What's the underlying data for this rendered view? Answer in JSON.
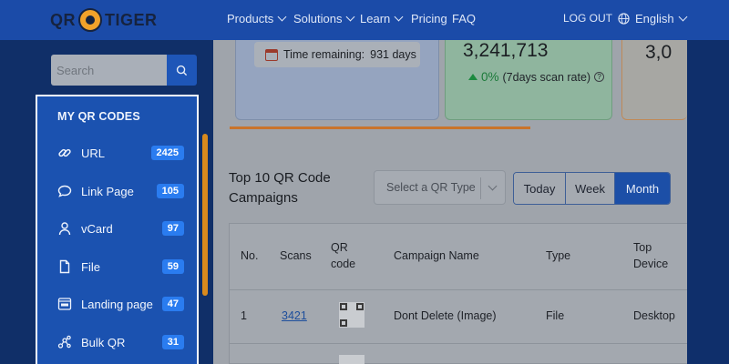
{
  "nav": {
    "logo_left": "QR",
    "logo_right": "TIGER",
    "items": [
      {
        "label": "Products",
        "dropdown": true
      },
      {
        "label": "Solutions",
        "dropdown": true
      },
      {
        "label": "Learn",
        "dropdown": true
      },
      {
        "label": "Pricing",
        "dropdown": false
      },
      {
        "label": "FAQ",
        "dropdown": false
      }
    ],
    "logout": "LOG OUT",
    "language": "English"
  },
  "sidebar": {
    "search_placeholder": "Search",
    "title": "MY QR CODES",
    "items": [
      {
        "label": "URL",
        "count": "2425",
        "icon": "link-icon"
      },
      {
        "label": "Link Page",
        "count": "105",
        "icon": "chat-bubble-icon"
      },
      {
        "label": "vCard",
        "count": "97",
        "icon": "user-icon"
      },
      {
        "label": "File",
        "count": "59",
        "icon": "file-icon"
      },
      {
        "label": "Landing page",
        "count": "47",
        "icon": "landing-page-icon"
      },
      {
        "label": "Bulk QR",
        "count": "31",
        "icon": "bulk-qr-icon"
      }
    ]
  },
  "stats": {
    "time_remaining_label": "Time remaining:",
    "time_remaining_value": "931 days",
    "scans_total": "3,241,713",
    "scan_rate_pct": "0%",
    "scan_rate_label": "(7days scan rate)",
    "third_value": "3,0"
  },
  "campaigns": {
    "title": "Top 10 QR Code Campaigns",
    "select_placeholder": "Select a QR Type",
    "ranges": [
      "Today",
      "Week",
      "Month"
    ],
    "active_range": "Month",
    "columns": [
      "No.",
      "Scans",
      "QR code",
      "Campaign Name",
      "Type",
      "Top Device"
    ],
    "rows": [
      {
        "no": "1",
        "scans": "3421",
        "name": "Dont Delete (Image)",
        "type": "File",
        "device": "Desktop"
      }
    ]
  },
  "colors": {
    "nav_bg": "#1b4ba8",
    "sidebar_bg": "#1b52b0",
    "badge": "#2a7cf0",
    "active_tab": "#1c4fa7"
  }
}
